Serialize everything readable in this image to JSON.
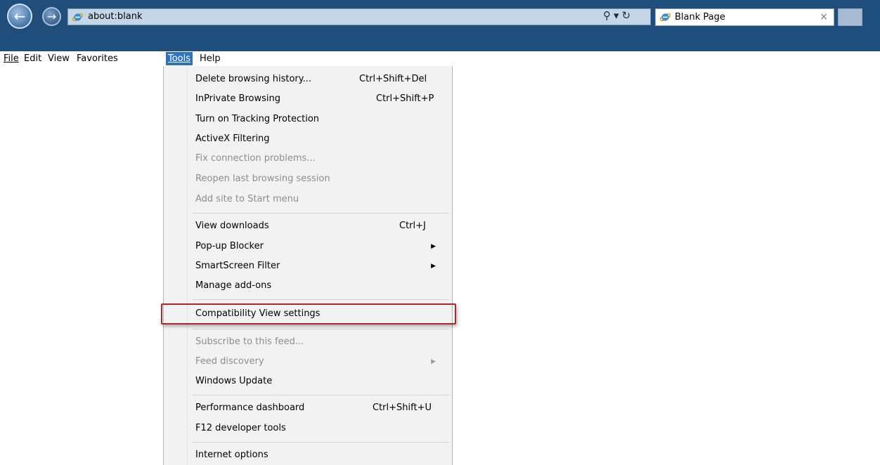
{
  "browser": {
    "address": "about:blank",
    "tab_title": "Blank Page",
    "tab_close": "×",
    "search_glyph": "⚲",
    "dropdown_glyph": "▾",
    "refresh_glyph": "↻",
    "back_glyph": "←",
    "forward_glyph": "→",
    "icons": [
      "back-icon",
      "forward-icon",
      "ie-logo-icon",
      "search-icon",
      "refresh-icon",
      "close-icon"
    ]
  },
  "menubar": {
    "file": "File",
    "edit": "Edit",
    "view": "View",
    "favorites": "Favorites",
    "tools": "Tools",
    "help": "Help"
  },
  "tools_menu": {
    "items": [
      {
        "label": "Delete browsing history...",
        "shortcut": "Ctrl+Shift+Del",
        "enabled": true
      },
      {
        "label": "InPrivate Browsing",
        "shortcut": "Ctrl+Shift+P",
        "enabled": true
      },
      {
        "label": "Turn on Tracking Protection",
        "shortcut": "",
        "enabled": true
      },
      {
        "label": "ActiveX Filtering",
        "shortcut": "",
        "enabled": true
      },
      {
        "label": "Fix connection problems...",
        "shortcut": "",
        "enabled": false
      },
      {
        "label": "Reopen last browsing session",
        "shortcut": "",
        "enabled": false
      },
      {
        "label": "Add site to Start menu",
        "shortcut": "",
        "enabled": false
      },
      {
        "label": "View downloads",
        "shortcut": "Ctrl+J",
        "enabled": true
      },
      {
        "label": "Pop-up Blocker",
        "shortcut": "",
        "enabled": true,
        "submenu": true
      },
      {
        "label": "SmartScreen Filter",
        "shortcut": "",
        "enabled": true,
        "submenu": true
      },
      {
        "label": "Manage add-ons",
        "shortcut": "",
        "enabled": true
      },
      {
        "label": "Compatibility View settings",
        "shortcut": "",
        "enabled": true,
        "highlighted": true
      },
      {
        "label": "Subscribe to this feed...",
        "shortcut": "",
        "enabled": false
      },
      {
        "label": "Feed discovery",
        "shortcut": "",
        "enabled": false,
        "submenu": true
      },
      {
        "label": "Windows Update",
        "shortcut": "",
        "enabled": true
      },
      {
        "label": "Performance dashboard",
        "shortcut": "Ctrl+Shift+U",
        "enabled": true
      },
      {
        "label": "F12 developer tools",
        "shortcut": "",
        "enabled": true
      },
      {
        "label": "Internet options",
        "shortcut": "",
        "enabled": true
      }
    ]
  },
  "colors": {
    "titlebar": "#1f4d7c",
    "menu_active": "#2e73c2",
    "highlight_border": "#b3252b",
    "disabled_text": "#8d8d8d"
  }
}
